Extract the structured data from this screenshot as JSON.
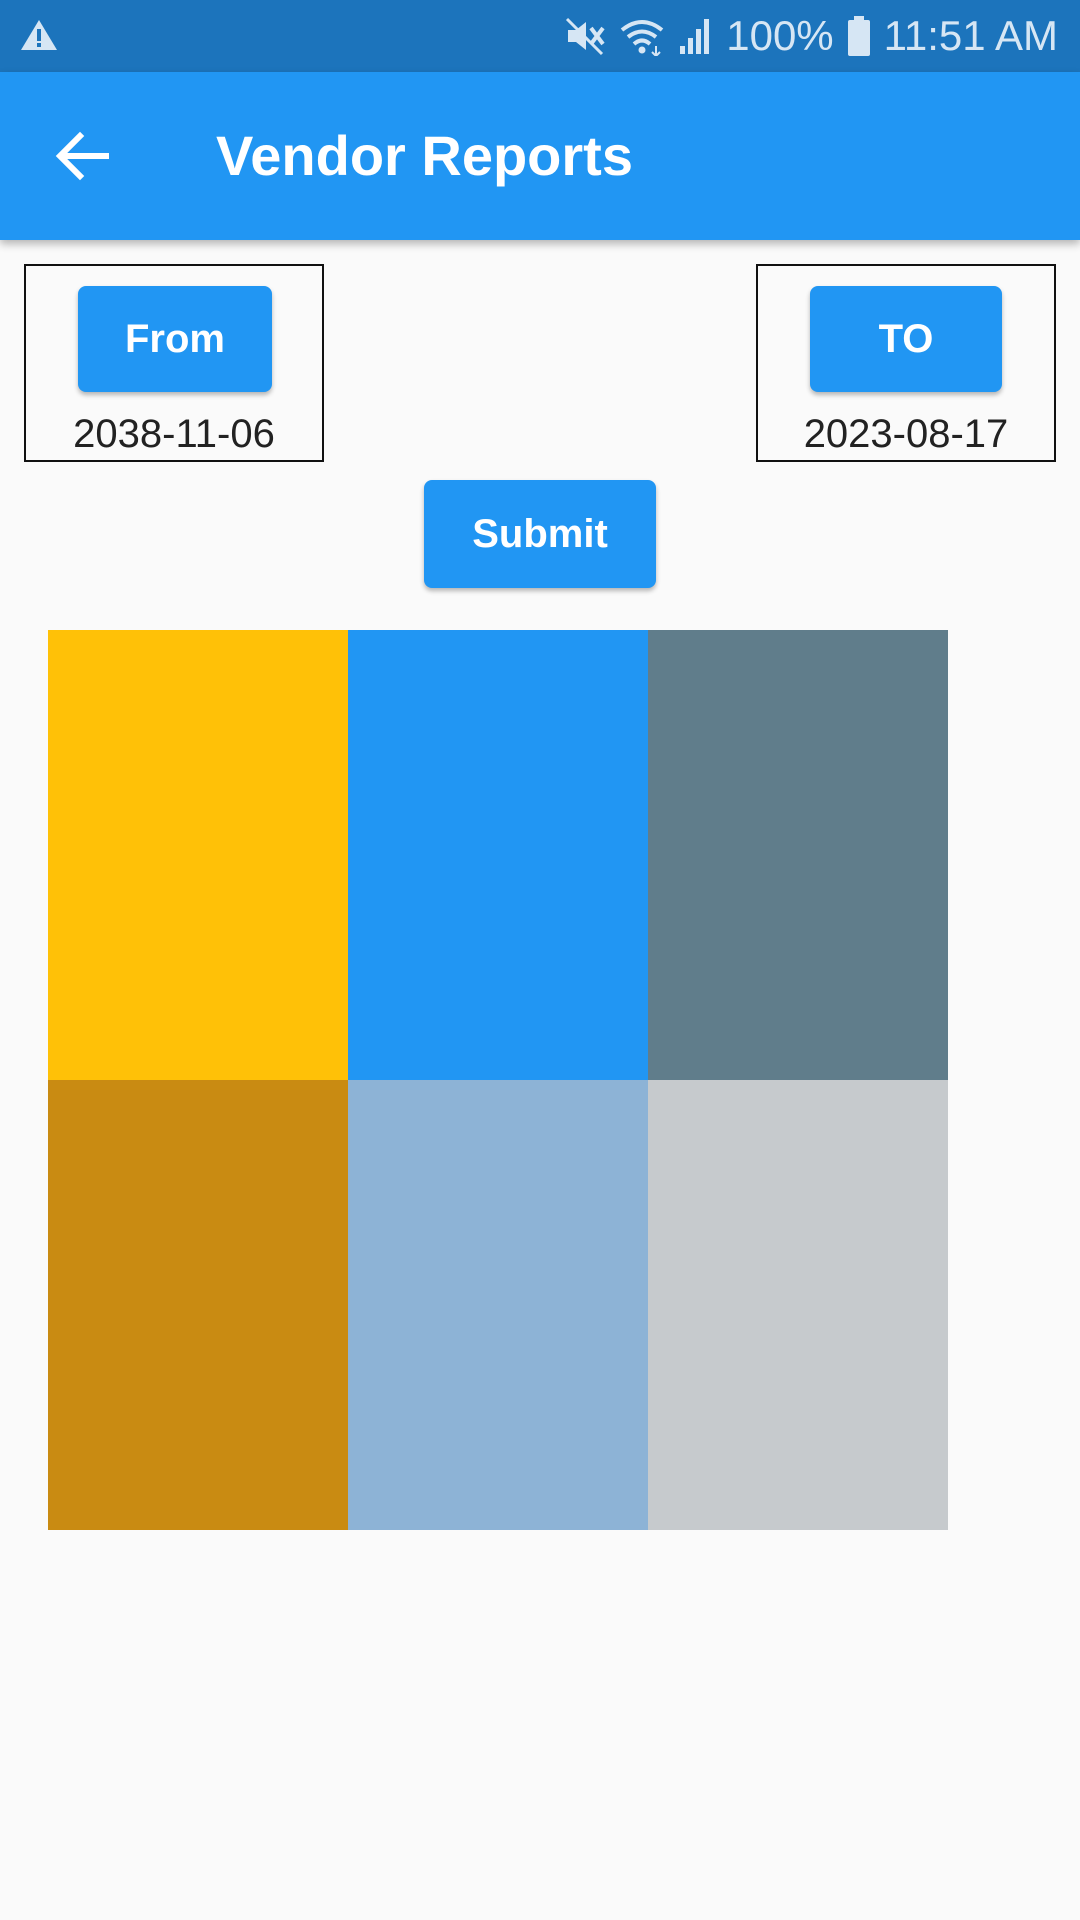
{
  "status_bar": {
    "battery": "100%",
    "time": "11:51 AM",
    "icons": [
      "warning-icon",
      "mute-icon",
      "wifi-icon",
      "signal-icon",
      "battery-icon"
    ]
  },
  "app_bar": {
    "title": "Vendor Reports",
    "back_icon": "arrow-left-icon"
  },
  "from": {
    "button_label": "From",
    "date": "2038-11-06"
  },
  "to": {
    "button_label": "TO",
    "date": "2023-08-17"
  },
  "submit": {
    "label": "Submit"
  },
  "tiles": [
    {
      "color": "#ffc107"
    },
    {
      "color": "#2196f3"
    },
    {
      "color": "#607d8b"
    },
    {
      "color": "#c98b12"
    },
    {
      "color": "#8db3d6"
    },
    {
      "color": "#c6cacd"
    }
  ]
}
